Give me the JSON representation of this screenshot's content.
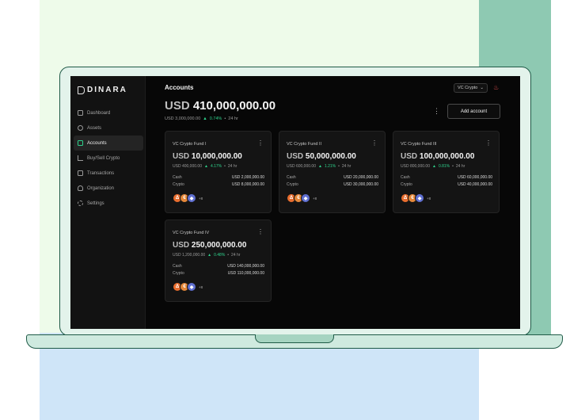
{
  "app": {
    "logo": "DINARA",
    "page_title": "Accounts"
  },
  "sidebar": {
    "items": [
      {
        "label": "Dashboard",
        "icon": "grid-icon"
      },
      {
        "label": "Assets",
        "icon": "coins-icon"
      },
      {
        "label": "Accounts",
        "icon": "wallet-icon",
        "active": true
      },
      {
        "label": "Buy/Sell Crypto",
        "icon": "chart-icon"
      },
      {
        "label": "Transactions",
        "icon": "document-icon"
      },
      {
        "label": "Organization",
        "icon": "user-icon"
      },
      {
        "label": "Settings",
        "icon": "gear-icon"
      }
    ]
  },
  "header": {
    "filter_select": "VC Crypto",
    "total_currency": "USD",
    "total_amount": "410,000,000.00",
    "change_amount": "USD 3,000,000.00",
    "change_pct": "0.74%",
    "period": "24 hr",
    "add_button": "Add account"
  },
  "cards": [
    {
      "name": "VC Crypto Fund I",
      "currency": "USD",
      "amount": "10,000,000.00",
      "change_amount": "USD 400,000.00",
      "change_pct": "4.17%",
      "period": "24 hr",
      "cash_label": "Cash",
      "cash_value": "USD 2,000,000.00",
      "crypto_label": "Crypto",
      "crypto_value": "USD 8,000,000.00",
      "more": "+8"
    },
    {
      "name": "VC Crypto Fund II",
      "currency": "USD",
      "amount": "50,000,000.00",
      "change_amount": "USD 600,000.00",
      "change_pct": "1.21%",
      "period": "24 hr",
      "cash_label": "Cash",
      "cash_value": "USD 20,000,000.00",
      "crypto_label": "Crypto",
      "crypto_value": "USD 30,000,000.00",
      "more": "+8"
    },
    {
      "name": "VC Crypto Fund III",
      "currency": "USD",
      "amount": "100,000,000.00",
      "change_amount": "USD 800,000.00",
      "change_pct": "0.81%",
      "period": "24 hr",
      "cash_label": "Cash",
      "cash_value": "USD 60,000,000.00",
      "crypto_label": "Crypto",
      "crypto_value": "USD 40,000,000.00",
      "more": "+8"
    },
    {
      "name": "VC Crypto Fund IV",
      "currency": "USD",
      "amount": "250,000,000.00",
      "change_amount": "USD 1,200,000.00",
      "change_pct": "0.48%",
      "period": "24 hr",
      "cash_label": "Cash",
      "cash_value": "USD 140,000,000.00",
      "crypto_label": "Crypto",
      "crypto_value": "USD 110,000,000.00",
      "more": "+8"
    }
  ],
  "colors": {
    "accent": "#2fd28c",
    "screen_bg": "#070707",
    "card_bg": "#141414",
    "frame": "#1f5a47"
  }
}
